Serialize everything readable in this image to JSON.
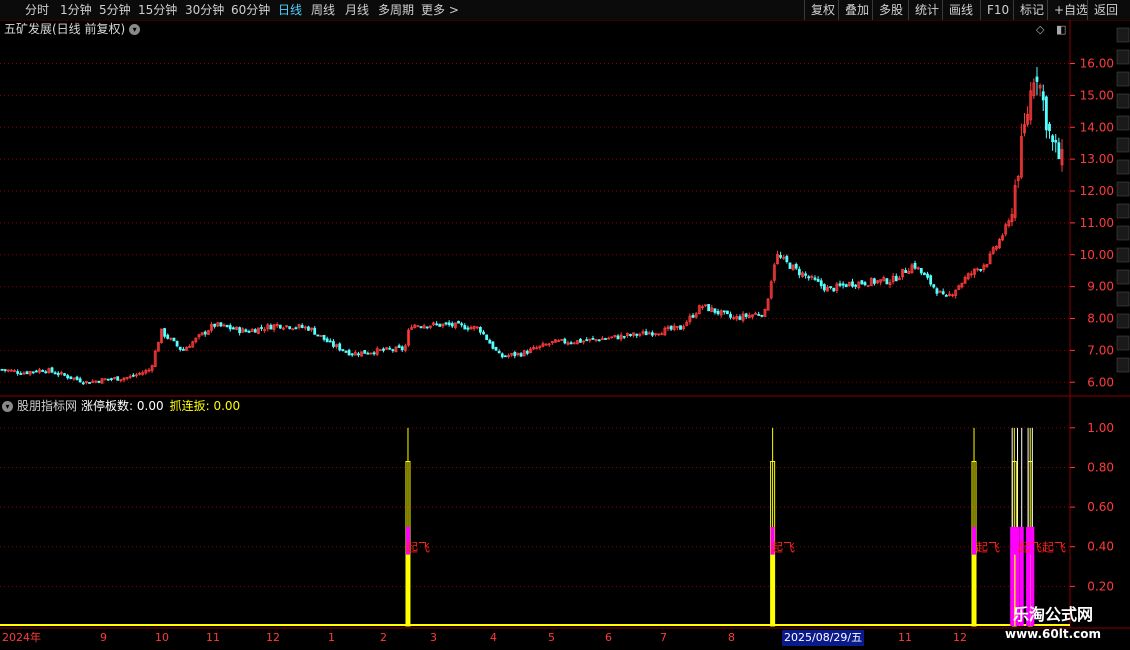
{
  "toolbar": {
    "periods": [
      "分时",
      "1分钟",
      "5分钟",
      "15分钟",
      "30分钟",
      "60分钟",
      "日线",
      "周线",
      "月线",
      "多周期",
      "更多 >"
    ],
    "active_period": "日线",
    "buttons": [
      "复权",
      "叠加",
      "多股",
      "统计",
      "画线",
      "F10",
      "标记",
      "+自选",
      "返回"
    ]
  },
  "main_chart": {
    "title": "五矿发展(日线 前复权)",
    "y_ticks": [
      "16.00",
      "15.00",
      "14.00",
      "13.00",
      "12.00",
      "11.00",
      "10.00",
      "9.00",
      "8.00",
      "7.00",
      "6.00"
    ]
  },
  "indicator": {
    "name": "股朋指标网",
    "zt_label": "涨停板数: 0.00",
    "zlb_label": "抓连扳: 0.00",
    "y_ticks": [
      "1.00",
      "0.80",
      "0.60",
      "0.40",
      "0.20"
    ],
    "annotations": [
      "起飞",
      "起飞",
      "起飞",
      "起飞起飞"
    ]
  },
  "x_axis": {
    "labels": [
      "2024年",
      "9",
      "10",
      "11",
      "12",
      "1",
      "2",
      "3",
      "4",
      "5",
      "6",
      "7",
      "8",
      "11",
      "12"
    ],
    "crosshair_date": "2025/08/29/五"
  },
  "watermark": {
    "title": "乐淘公式网",
    "url": "www.60lt.com"
  },
  "colors": {
    "up": "#ff3b3b",
    "down": "#54ffff",
    "grid": "#8b0000",
    "signal_yellow": "#ffff00",
    "signal_magenta": "#ff00ff"
  },
  "chart_data": {
    "type": "candlestick",
    "y_range": [
      5.6,
      16.8
    ],
    "close_path": [
      [
        0,
        6.4
      ],
      [
        0.02,
        6.3
      ],
      [
        0.04,
        6.4
      ],
      [
        0.06,
        6.2
      ],
      [
        0.08,
        6.0
      ],
      [
        0.1,
        6.1
      ],
      [
        0.12,
        6.15
      ],
      [
        0.14,
        6.4
      ],
      [
        0.15,
        7.6
      ],
      [
        0.17,
        7.0
      ],
      [
        0.2,
        7.8
      ],
      [
        0.23,
        7.6
      ],
      [
        0.26,
        7.8
      ],
      [
        0.29,
        7.7
      ],
      [
        0.31,
        7.2
      ],
      [
        0.33,
        6.9
      ],
      [
        0.36,
        7.0
      ],
      [
        0.38,
        7.05
      ],
      [
        0.385,
        7.8
      ],
      [
        0.42,
        7.8
      ],
      [
        0.45,
        7.7
      ],
      [
        0.47,
        6.8
      ],
      [
        0.49,
        6.9
      ],
      [
        0.52,
        7.25
      ],
      [
        0.55,
        7.3
      ],
      [
        0.6,
        7.5
      ],
      [
        0.64,
        7.7
      ],
      [
        0.66,
        8.4
      ],
      [
        0.69,
        8.0
      ],
      [
        0.72,
        8.2
      ],
      [
        0.73,
        10.0
      ],
      [
        0.75,
        9.5
      ],
      [
        0.78,
        8.9
      ],
      [
        0.8,
        9.1
      ],
      [
        0.84,
        9.2
      ],
      [
        0.86,
        9.7
      ],
      [
        0.89,
        8.6
      ],
      [
        0.91,
        9.3
      ],
      [
        0.93,
        9.8
      ],
      [
        0.95,
        11.0
      ],
      [
        0.96,
        13.0
      ],
      [
        0.975,
        16.0
      ],
      [
        0.99,
        13.5
      ],
      [
        1.0,
        12.9
      ]
    ],
    "signal_positions": [
      0.383,
      0.727,
      0.917,
      0.955,
      0.97
    ],
    "signal_max": 1.0
  }
}
